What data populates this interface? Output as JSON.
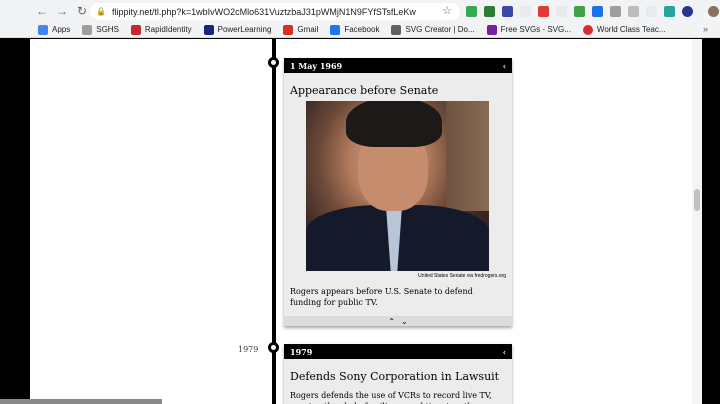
{
  "browser": {
    "url": "flippity.net/tl.php?k=1wbIvWO2cMlo631VuztzbaJ31pWMjN1N9FYfSTsfLeKw",
    "nav_icons": [
      "back-arrow-icon",
      "forward-arrow-icon",
      "reload-icon"
    ],
    "bookmarks": [
      {
        "label": "Apps",
        "color": "#4285f4"
      },
      {
        "label": "SGHS",
        "color": "#9e9e9e"
      },
      {
        "label": "RapidIdentity",
        "color": "#c62828"
      },
      {
        "label": "PowerLearning",
        "color": "#1a237e"
      },
      {
        "label": "Gmail",
        "color": "#d93025"
      },
      {
        "label": "Facebook",
        "color": "#1877f2"
      },
      {
        "label": "SVG Creator | Do...",
        "color": "#616161"
      },
      {
        "label": "Free SVGs - SVG...",
        "color": "#7b1fa2"
      },
      {
        "label": "World Class Teac...",
        "color": "#d32f2f"
      }
    ],
    "more_bookmarks": "»"
  },
  "timeline": {
    "events": [
      {
        "date": "1 May 1969",
        "title": "Appearance before Senate",
        "image_credit": "United States Senate via fredrogers.org",
        "description": "Rogers appears before U.S. Senate to defend funding for public TV."
      },
      {
        "date": "1979",
        "year_marker": "1979",
        "title": "Defends Sony Corporation in Lawsuit",
        "description": "Rogers defends the use of VCRs to record live TV, arguing they help families spend time together."
      }
    ]
  }
}
